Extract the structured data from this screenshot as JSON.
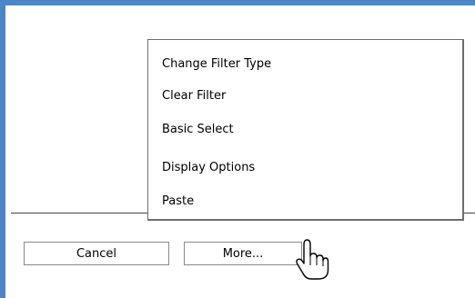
{
  "menu": {
    "items": [
      {
        "label": "Change Filter Type"
      },
      {
        "label": "Clear Filter"
      },
      {
        "label": "Basic Select"
      },
      {
        "label": "Display Options"
      },
      {
        "label": "Paste"
      }
    ]
  },
  "buttons": {
    "cancel_label": "Cancel",
    "more_label": "More..."
  },
  "colors": {
    "window_border": "#4a86c8",
    "menu_border": "#6e6e6e",
    "button_border": "#8a8a8a"
  },
  "cursor": "hand-pointer-icon"
}
